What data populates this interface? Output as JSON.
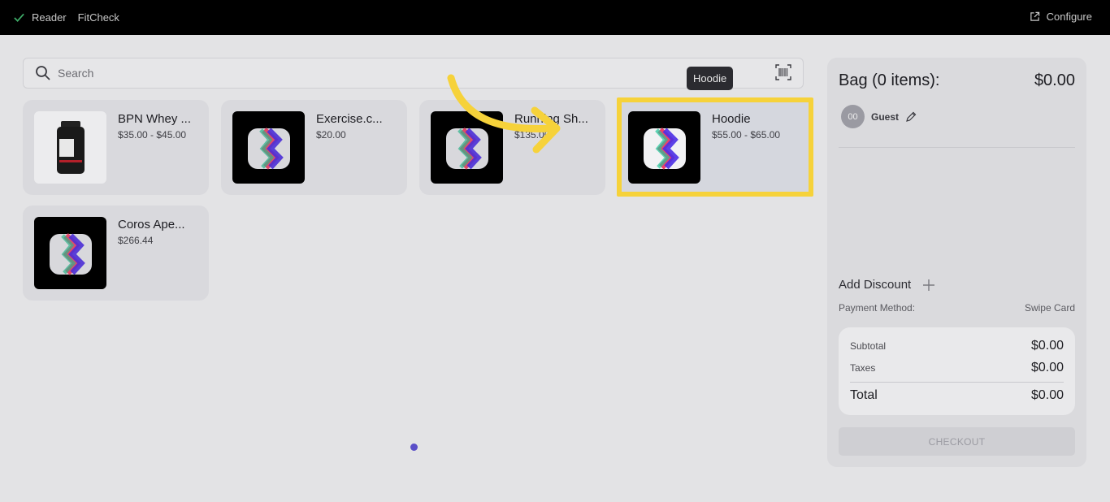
{
  "topbar": {
    "reader_label": "Reader",
    "app_name": "FitCheck",
    "configure_label": "Configure"
  },
  "search": {
    "placeholder": "Search"
  },
  "tooltip": "Hoodie",
  "products": [
    {
      "name": "BPN Whey ...",
      "price": "$35.00 - $45.00",
      "icon": "protein-tub-image"
    },
    {
      "name": "Exercise.c...",
      "price": "$20.00",
      "icon": "app-logo-image"
    },
    {
      "name": "Running Sh...",
      "price": "$135.00",
      "icon": "app-logo-image"
    },
    {
      "name": "Hoodie",
      "price": "$55.00 - $65.00",
      "icon": "app-logo-image",
      "highlighted": true
    },
    {
      "name": "Coros Ape...",
      "price": "$266.44",
      "icon": "app-logo-image"
    }
  ],
  "bag": {
    "title": "Bag (0 items):",
    "total": "$0.00",
    "guest_initials": "00",
    "guest_name": "Guest",
    "add_discount": "Add Discount",
    "payment_method_label": "Payment Method:",
    "payment_method_value": "Swipe Card",
    "subtotal_label": "Subtotal",
    "subtotal_value": "$0.00",
    "taxes_label": "Taxes",
    "taxes_value": "$0.00",
    "grand_total_label": "Total",
    "grand_total_value": "$0.00",
    "checkout_label": "CHECKOUT"
  },
  "colors": {
    "highlight": "#f6d23a",
    "topbar": "#000000",
    "status_check": "#3fae6a",
    "page_indicator": "#5a4fc8"
  }
}
